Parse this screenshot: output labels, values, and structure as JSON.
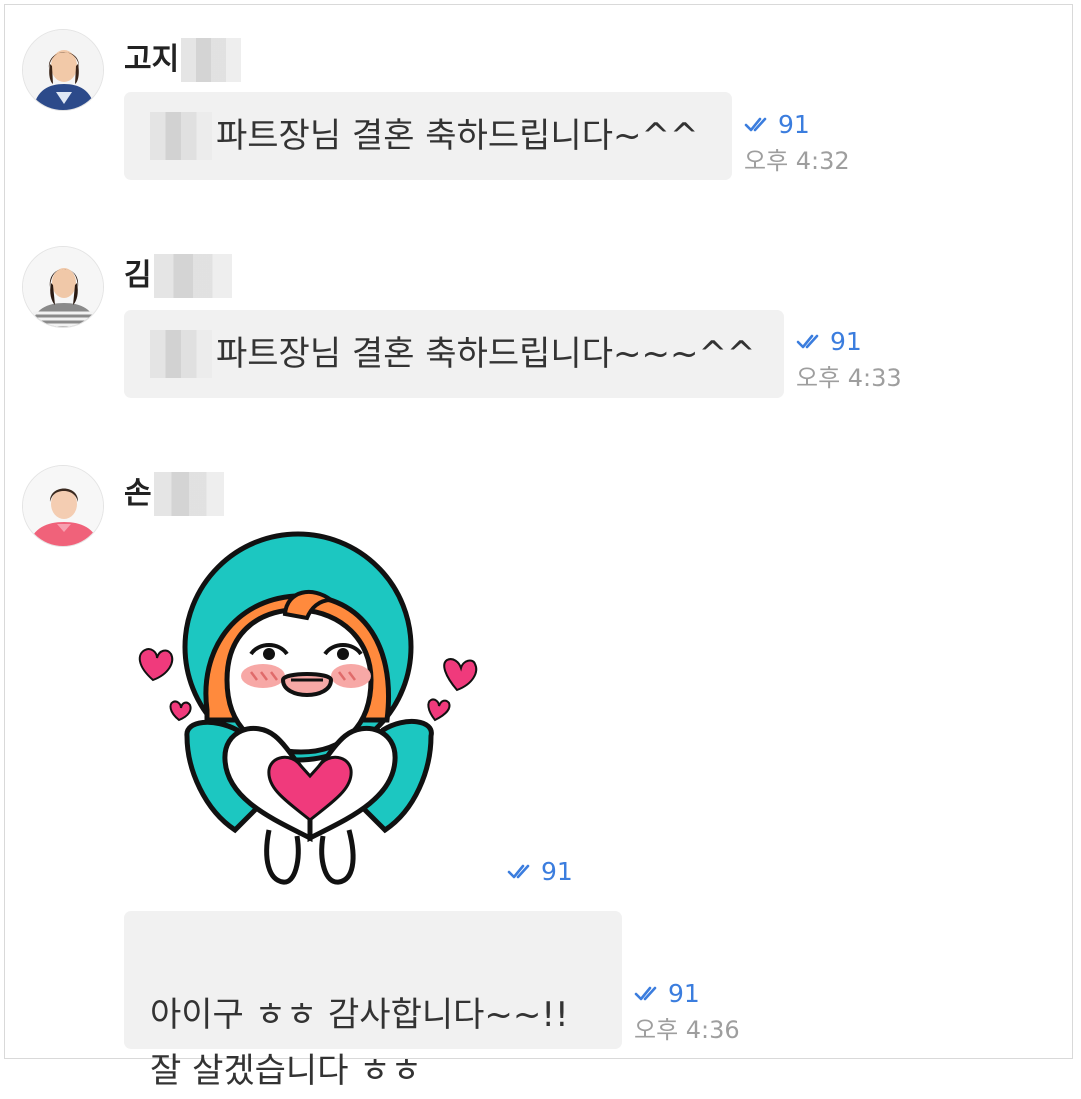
{
  "messages": [
    {
      "sender": "고지",
      "text": "파트장님 결혼 축하드립니다~^^",
      "read_count": "91",
      "time": "오후 4:32"
    },
    {
      "sender": "김",
      "text": "파트장님 결혼 축하드립니다~~~^^",
      "read_count": "91",
      "time": "오후 4:33"
    },
    {
      "sender": "손",
      "sticker": "heart-hands-sticker",
      "sticker_read_count": "91",
      "text": "아이구 ㅎㅎ 감사합니다~~!!\n잘 살겠습니다 ㅎㅎ",
      "read_count": "91",
      "time": "오후 4:36"
    }
  ],
  "colors": {
    "read_indicator": "#3b7dde",
    "bubble_bg": "#f1f1f1",
    "time_text": "#9e9e9e",
    "sticker_teal": "#1cc7c1",
    "sticker_orange": "#ff8a3d",
    "sticker_pink": "#f03a7c"
  },
  "icons": [
    "double-check-icon"
  ]
}
